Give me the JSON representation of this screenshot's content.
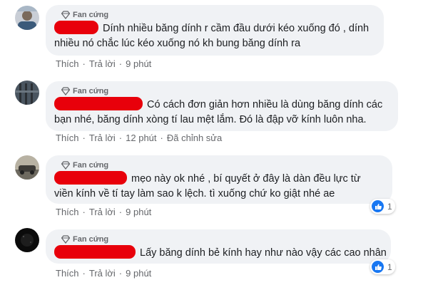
{
  "colors": {
    "bubble": "#f0f2f5",
    "redaction": "#e8000b",
    "like": "#1877f2",
    "meta": "#65676b"
  },
  "comments": [
    {
      "badge": "Fan cứng",
      "lines": [
        "Dính nhiều băng dính r cầm đầu dưới kéo xuống đó , dính",
        "nhiều nó chắc lúc kéo xuống nó kh bung băng dính ra"
      ],
      "actions": {
        "like": "Thích",
        "reply": "Trả lời",
        "time": "9 phút"
      }
    },
    {
      "badge": "Fan cứng",
      "lines": [
        "Có cách đơn giản hơn nhiều là dùng băng dính các",
        "bạn nhé, băng dính xòng tí lau mệt lắm. Đó là đập vỡ kính luôn nha."
      ],
      "actions": {
        "like": "Thích",
        "reply": "Trả lời",
        "time": "12 phút",
        "edited": "Đã chỉnh sửa"
      }
    },
    {
      "badge": "Fan cứng",
      "lines": [
        "mẹo này ok nhé , bí quyết ở đây là dàn đều lực từ",
        "viền kính về tí tay làm sao k lệch. tì xuống chứ ko giật nhé ae"
      ],
      "actions": {
        "like": "Thích",
        "reply": "Trả lời",
        "time": "9 phút"
      },
      "reaction_count": "1"
    },
    {
      "badge": "Fan cứng",
      "lines": [
        "Lấy băng dính bẻ kính hay như nào vậy các cao nhân"
      ],
      "actions": {
        "like": "Thích",
        "reply": "Trả lời",
        "time": "9 phút"
      },
      "reaction_count": "1"
    }
  ]
}
